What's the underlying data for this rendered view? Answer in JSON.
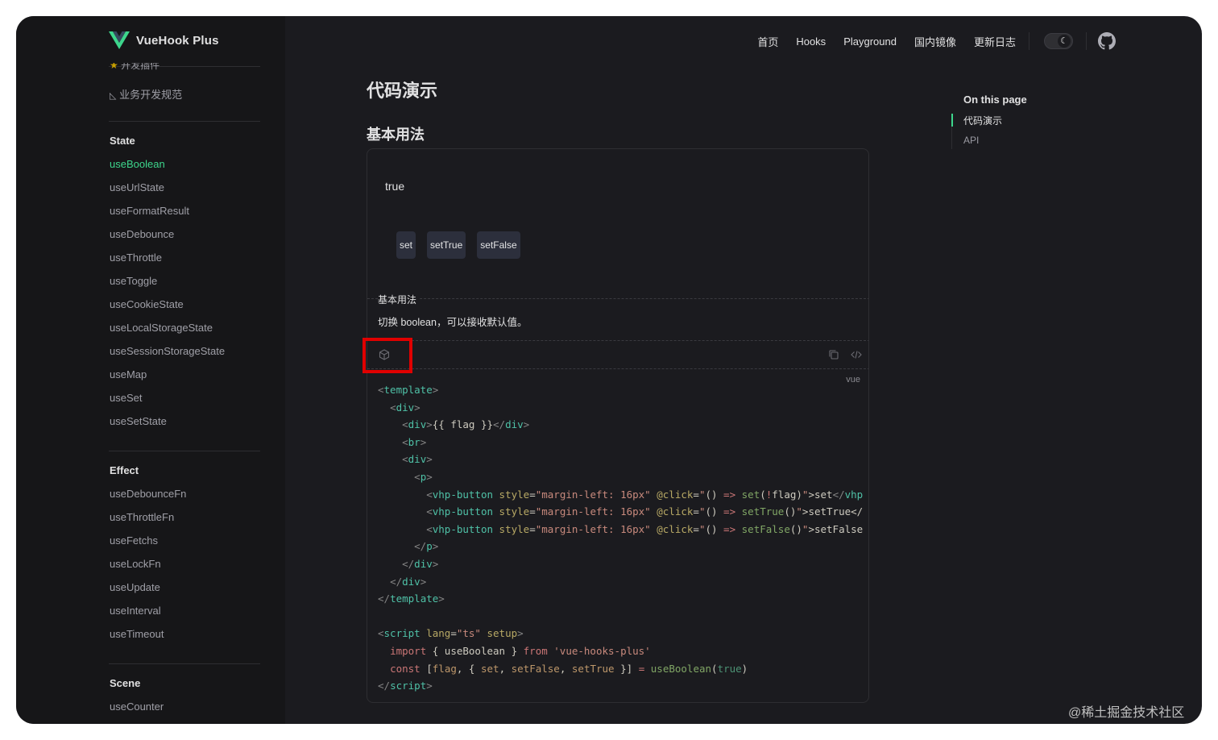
{
  "brand": {
    "name": "VueHook Plus",
    "logo": "vue-logo"
  },
  "sidebar": {
    "cut_item": "开发插件",
    "top_items": [
      {
        "icon": "ruler-icon",
        "label": "业务开发规范"
      }
    ],
    "groups": [
      {
        "title": "State",
        "items": [
          "useBoolean",
          "useUrlState",
          "useFormatResult",
          "useDebounce",
          "useThrottle",
          "useToggle",
          "useCookieState",
          "useLocalStorageState",
          "useSessionStorageState",
          "useMap",
          "useSet",
          "useSetState"
        ],
        "active": "useBoolean"
      },
      {
        "title": "Effect",
        "items": [
          "useDebounceFn",
          "useThrottleFn",
          "useFetchs",
          "useLockFn",
          "useUpdate",
          "useInterval",
          "useTimeout"
        ]
      },
      {
        "title": "Scene",
        "items": [
          "useCounter"
        ]
      }
    ]
  },
  "nav": {
    "links": [
      "首页",
      "Hooks",
      "Playground",
      "国内镜像",
      "更新日志"
    ],
    "theme_icon": "moon-icon",
    "github_icon": "github-icon"
  },
  "main": {
    "title": "代码演示",
    "section": "基本用法",
    "demo": {
      "value": "true",
      "buttons": [
        "set",
        "setTrue",
        "setFalse"
      ],
      "desc_title": "基本用法",
      "desc_text": "切换 boolean，可以接收默认值。",
      "toolbar_icons": [
        "codesandbox-icon",
        "copy-icon",
        "code-icon"
      ],
      "lang": "vue"
    }
  },
  "aside": {
    "title": "On this page",
    "items": [
      "代码演示",
      "API"
    ],
    "active": "代码演示"
  },
  "watermark": "@稀土掘金技术社区",
  "colors": {
    "accent": "#3dd68c",
    "highlight": "#e00000",
    "background": "#1b1b1f",
    "sidebar": "#161618"
  }
}
